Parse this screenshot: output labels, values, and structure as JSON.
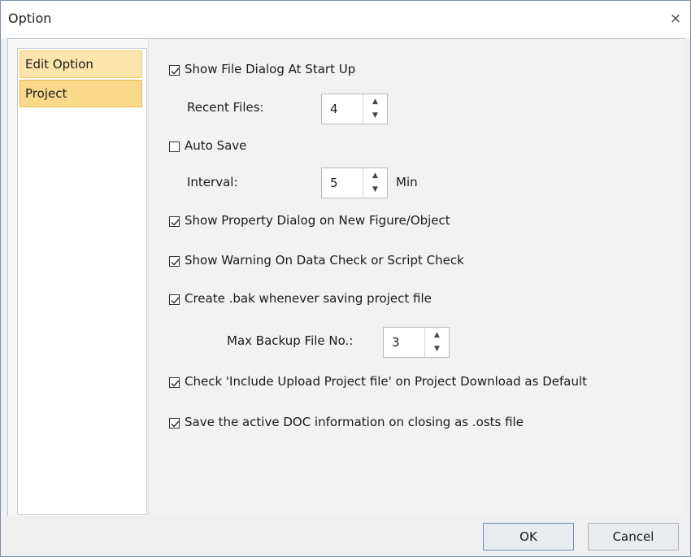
{
  "window": {
    "title": "Option",
    "close_glyph": "×"
  },
  "sidebar": {
    "items": [
      {
        "label": "Edit Option",
        "selected": false
      },
      {
        "label": "Project",
        "selected": true
      }
    ]
  },
  "options": {
    "show_file_dialog": {
      "label": "Show File Dialog At Start Up",
      "checked": true
    },
    "recent_files": {
      "label": "Recent Files:",
      "value": "4"
    },
    "auto_save": {
      "label": "Auto Save",
      "checked": false
    },
    "interval": {
      "label": "Interval:",
      "value": "5",
      "unit": "Min"
    },
    "show_property_dialog": {
      "label": "Show Property Dialog on New Figure/Object",
      "checked": true
    },
    "show_warning": {
      "label": "Show Warning On Data Check or Script Check",
      "checked": true
    },
    "create_bak": {
      "label": "Create .bak whenever saving project file",
      "checked": true
    },
    "max_backup": {
      "label": "Max Backup File No.:",
      "value": "3"
    },
    "include_upload": {
      "label": "Check 'Include Upload Project file' on Project Download as Default",
      "checked": true
    },
    "save_active_doc": {
      "label": "Save the active DOC information on closing as .osts file",
      "checked": true
    }
  },
  "buttons": {
    "ok": "OK",
    "cancel": "Cancel"
  },
  "icons": {
    "spin_up": "▲",
    "spin_down": "▼",
    "check": "check-icon"
  }
}
